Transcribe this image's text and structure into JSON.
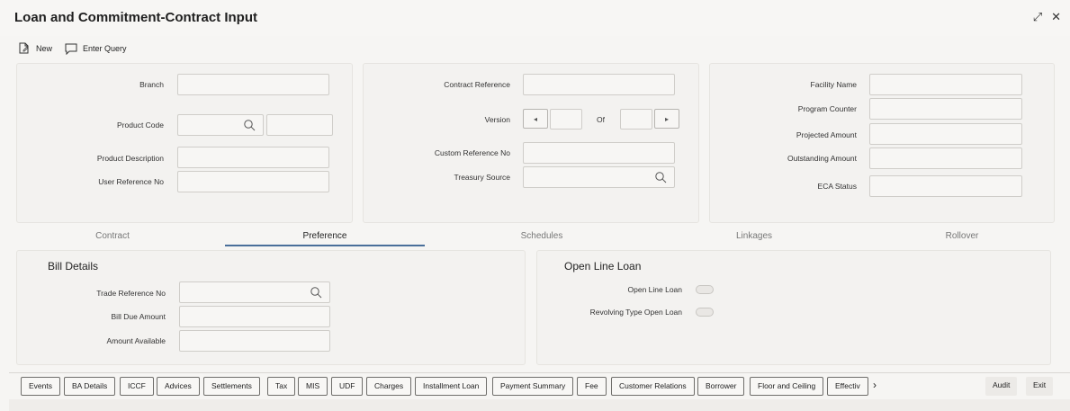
{
  "window": {
    "title": "Loan and Commitment-Contract Input",
    "expand_icon": "expand-icon",
    "close_icon": "close-icon"
  },
  "toolbar": {
    "new_label": "New",
    "enter_query_label": "Enter Query"
  },
  "header": {
    "branch_label": "Branch",
    "product_code_label": "Product Code",
    "product_description_label": "Product Description",
    "user_reference_label": "User Reference No",
    "contract_reference_label": "Contract Reference",
    "version_label": "Version",
    "of_label": "Of",
    "custom_reference_label": "Custom Reference No",
    "treasury_source_label": "Treasury Source",
    "facility_name_label": "Facility Name",
    "program_counter_label": "Program Counter",
    "projected_amount_label": "Projected Amount",
    "outstanding_amount_label": "Outstanding Amount",
    "eca_status_label": "ECA Status",
    "prev_symbol": "◂",
    "next_symbol": "▸"
  },
  "tabs": [
    {
      "label": "Contract"
    },
    {
      "label": "Preference"
    },
    {
      "label": "Schedules"
    },
    {
      "label": "Linkages"
    },
    {
      "label": "Rollover"
    }
  ],
  "active_tab": "Preference",
  "bill_details": {
    "title": "Bill Details",
    "trade_reference_label": "Trade Reference No",
    "bill_due_amount_label": "Bill Due Amount",
    "amount_available_label": "Amount Available"
  },
  "open_line_loan": {
    "title": "Open Line Loan",
    "open_line_loan_label": "Open Line Loan",
    "revolving_type_label": "Revolving Type Open Loan"
  },
  "bottom_buttons": [
    "Events",
    "BA Details",
    "ICCF",
    "Advices",
    "Settlements",
    "Tax",
    "MIS",
    "UDF",
    "Charges",
    "Installment Loan",
    "Payment Summary",
    "Fee",
    "Customer Relations",
    "Borrower",
    "Floor and Ceiling",
    "Effectiv"
  ],
  "more_symbol": "›",
  "audit_label": "Audit",
  "exit_label": "Exit"
}
